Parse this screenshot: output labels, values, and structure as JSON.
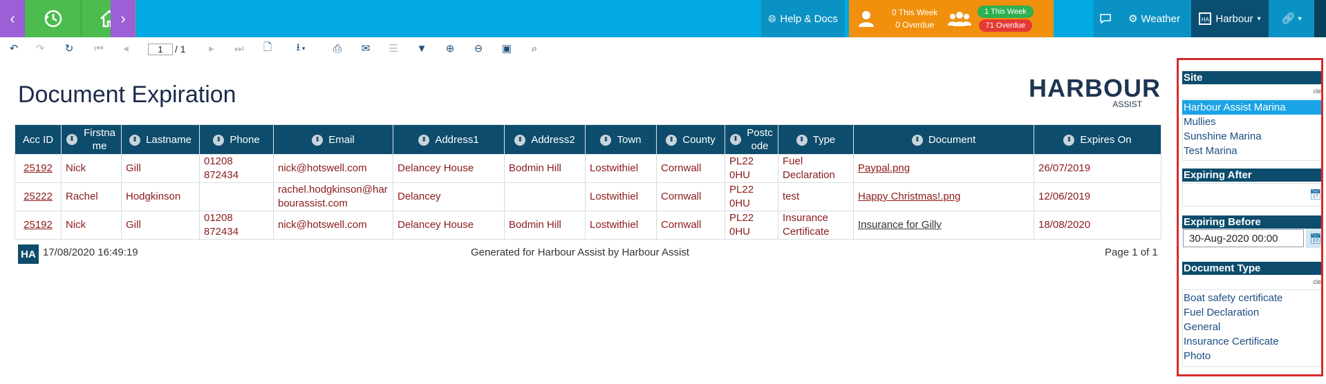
{
  "topbar": {
    "help_label": "Help & Docs",
    "this_week": "0 This Week",
    "overdue": "0 Overdue",
    "group_this_week": "1 This Week",
    "group_overdue": "71 Overdue",
    "weather_label": "Weather",
    "harbour_label": "Harbour"
  },
  "toolbar": {
    "page_current": "1",
    "page_total": "/ 1"
  },
  "report": {
    "title": "Document Expiration",
    "logo_text": "HARBOUR",
    "logo_sub": "ASSIST",
    "columns": [
      "Acc ID",
      "Firstname",
      "Lastname",
      "Phone",
      "Email",
      "Address1",
      "Address2",
      "Town",
      "County",
      "Postcode",
      "Type",
      "Document",
      "Expires On"
    ],
    "rows": [
      {
        "acc": "25192",
        "first": "Nick",
        "last": "Gill",
        "phone": "01208 872434",
        "email": "nick@hotswell.com",
        "addr1": "Delancey House",
        "addr2": "Bodmin Hill",
        "town": "Lostwithiel",
        "county": "Cornwall",
        "postcode": "PL22 0HU",
        "type": "Fuel Declaration",
        "document": "Paypal.png",
        "expires": "26/07/2019"
      },
      {
        "acc": "25222",
        "first": "Rachel",
        "last": "Hodgkinson",
        "phone": "",
        "email": "rachel.hodgkinson@harbourassist.com",
        "addr1": "Delancey",
        "addr2": "",
        "town": "Lostwithiel",
        "county": "Cornwall",
        "postcode": "PL22 0HU",
        "type": "test",
        "document": "Happy Christmas!.png",
        "expires": "12/06/2019"
      },
      {
        "acc": "25192",
        "first": "Nick",
        "last": "Gill",
        "phone": "01208 872434",
        "email": "nick@hotswell.com",
        "addr1": "Delancey House",
        "addr2": "Bodmin Hill",
        "town": "Lostwithiel",
        "county": "Cornwall",
        "postcode": "PL22 0HU",
        "type": "Insurance Certificate",
        "document": "Insurance for Gilly",
        "expires": "18/08/2020"
      }
    ],
    "footer_logo": "HA",
    "footer_date": "17/08/2020 16:49:19",
    "footer_generated": "Generated for Harbour Assist by Harbour Assist",
    "footer_page": "Page 1 of 1"
  },
  "panel": {
    "site_header": "Site",
    "clear_label": "cle",
    "sites": [
      "Harbour Assist Marina",
      "Mullies",
      "Sunshine Marina",
      "Test Marina"
    ],
    "selected_site": "Harbour Assist Marina",
    "expiring_after_header": "Expiring After",
    "expiring_after_value": "",
    "expiring_before_header": "Expiring Before",
    "expiring_before_value": "30-Aug-2020 00:00",
    "doc_type_header": "Document Type",
    "doc_types": [
      "Boat safety certificate",
      "Fuel Declaration",
      "General",
      "Insurance Certificate",
      "Photo"
    ]
  },
  "colors": {
    "topbar_blue": "#03a9e2",
    "purple": "#9c5fd6",
    "green": "#4cbc4f",
    "orange": "#f0900c",
    "header_navy": "#0d4c6c",
    "link_red": "#8b1a1a",
    "selected_blue": "#1aa3e6",
    "highlight_border": "#d62b2b"
  }
}
